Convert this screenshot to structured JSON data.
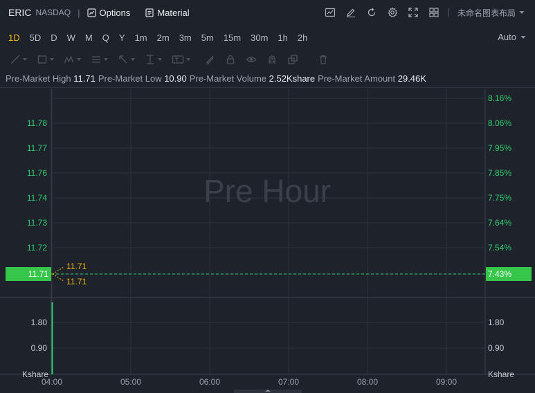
{
  "header": {
    "symbol": "ERIC",
    "exchange": "NASDAQ",
    "separator": "|",
    "options_label": "Options",
    "material_label": "Material",
    "layout_name": "未命名图表布局"
  },
  "timeframes": [
    {
      "label": "1D",
      "active": true
    },
    {
      "label": "5D",
      "active": false
    },
    {
      "label": "D",
      "active": false
    },
    {
      "label": "W",
      "active": false
    },
    {
      "label": "M",
      "active": false
    },
    {
      "label": "Q",
      "active": false
    },
    {
      "label": "Y",
      "active": false
    },
    {
      "label": "1m",
      "active": false
    },
    {
      "label": "2m",
      "active": false
    },
    {
      "label": "3m",
      "active": false
    },
    {
      "label": "5m",
      "active": false
    },
    {
      "label": "15m",
      "active": false
    },
    {
      "label": "30m",
      "active": false
    },
    {
      "label": "1h",
      "active": false
    },
    {
      "label": "2h",
      "active": false
    }
  ],
  "scale_mode": "Auto",
  "stats": [
    {
      "label": "Pre-Market High",
      "value": "11.71"
    },
    {
      "label": "Pre-Market Low",
      "value": "10.90"
    },
    {
      "label": "Pre-Market Volume",
      "value": "2.52Kshare"
    },
    {
      "label": "Pre-Market Amount",
      "value": "29.46K"
    }
  ],
  "colors": {
    "up": "#2ecc71",
    "accent": "#f0b90b",
    "price_tag_bg": "#35c64a",
    "background": "#1e232b",
    "grid": "#2c323b"
  },
  "chart_data": {
    "type": "line",
    "watermark": "Pre Hour",
    "price_axis": {
      "ticks": [
        "11.78",
        "11.77",
        "11.76",
        "11.74",
        "11.73",
        "11.72"
      ],
      "current_price": "11.71"
    },
    "percent_axis": {
      "ticks": [
        "8.16%",
        "8.06%",
        "7.95%",
        "7.85%",
        "7.75%",
        "7.64%",
        "7.54%"
      ],
      "current_percent": "7.43%"
    },
    "annotations": {
      "high_label": "11.71",
      "low_label": "11.71"
    },
    "volume_axis": {
      "ticks": [
        "1.80",
        "0.90"
      ],
      "unit": "Kshare"
    },
    "x_ticks": [
      "04:00",
      "05:00",
      "06:00",
      "07:00",
      "08:00",
      "09:00"
    ],
    "series": [
      {
        "x": "04:00",
        "price": 11.71,
        "volume": 2.52
      }
    ]
  }
}
